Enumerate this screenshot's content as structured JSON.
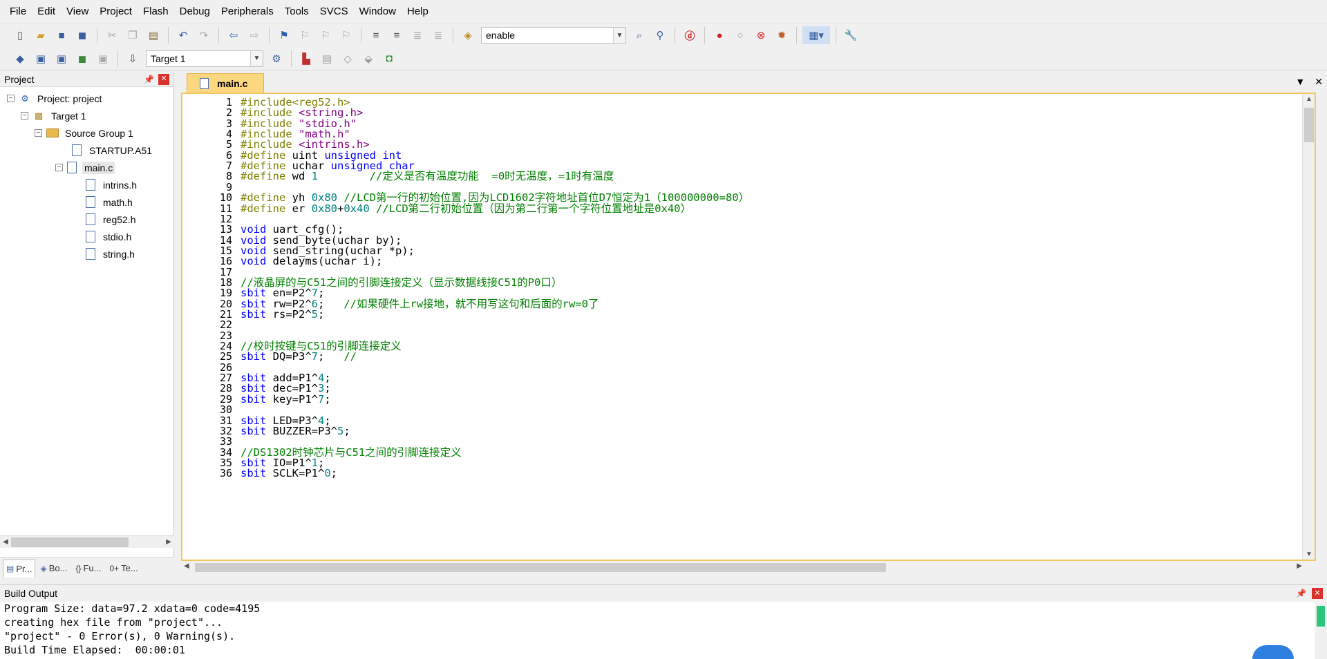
{
  "menu": [
    "File",
    "Edit",
    "View",
    "Project",
    "Flash",
    "Debug",
    "Peripherals",
    "Tools",
    "SVCS",
    "Window",
    "Help"
  ],
  "toolbar": {
    "find_combo_value": "enable",
    "target_combo_value": "Target 1"
  },
  "project_panel": {
    "title": "Project",
    "tree": [
      {
        "label": "Project: project",
        "level": 0,
        "kind": "project",
        "toggle": "-"
      },
      {
        "label": "Target 1",
        "level": 1,
        "kind": "target",
        "toggle": "-"
      },
      {
        "label": "Source Group 1",
        "level": 2,
        "kind": "folder",
        "toggle": "-"
      },
      {
        "label": "STARTUP.A51",
        "level": 3,
        "kind": "file",
        "toggle": ""
      },
      {
        "label": "main.c",
        "level": 3,
        "kind": "file",
        "toggle": "-",
        "selected": true
      },
      {
        "label": "intrins.h",
        "level": 4,
        "kind": "file",
        "toggle": ""
      },
      {
        "label": "math.h",
        "level": 4,
        "kind": "file",
        "toggle": ""
      },
      {
        "label": "reg52.h",
        "level": 4,
        "kind": "file",
        "toggle": ""
      },
      {
        "label": "stdio.h",
        "level": 4,
        "kind": "file",
        "toggle": ""
      },
      {
        "label": "string.h",
        "level": 4,
        "kind": "file",
        "toggle": ""
      }
    ],
    "bottom_tabs": [
      "Pr...",
      "Bo...",
      "Fu...",
      "Te..."
    ]
  },
  "editor": {
    "tab_label": "main.c",
    "lines": [
      {
        "n": "1",
        "parts": [
          [
            "pp",
            "#include<reg52.h>"
          ]
        ]
      },
      {
        "n": "2",
        "parts": [
          [
            "pp",
            "#include "
          ],
          [
            "str",
            "<string.h>"
          ]
        ]
      },
      {
        "n": "3",
        "parts": [
          [
            "pp",
            "#include "
          ],
          [
            "str",
            "\"stdio.h\""
          ]
        ]
      },
      {
        "n": "4",
        "parts": [
          [
            "pp",
            "#include "
          ],
          [
            "str",
            "\"math.h\""
          ]
        ]
      },
      {
        "n": "5",
        "parts": [
          [
            "pp",
            "#include "
          ],
          [
            "str",
            "<intrins.h>"
          ]
        ]
      },
      {
        "n": "6",
        "parts": [
          [
            "pp",
            "#define "
          ],
          [
            "",
            "uint "
          ],
          [
            "kw",
            "unsigned int"
          ]
        ]
      },
      {
        "n": "7",
        "parts": [
          [
            "pp",
            "#define "
          ],
          [
            "",
            "uchar "
          ],
          [
            "kw",
            "unsigned char"
          ]
        ]
      },
      {
        "n": "8",
        "parts": [
          [
            "pp",
            "#define "
          ],
          [
            "",
            "wd "
          ],
          [
            "num",
            "1"
          ],
          [
            "",
            "        "
          ],
          [
            "cm",
            "//定义是否有温度功能  =0时无温度，=1时有温度"
          ]
        ]
      },
      {
        "n": "9",
        "parts": []
      },
      {
        "n": "10",
        "parts": [
          [
            "pp",
            "#define "
          ],
          [
            "",
            "yh "
          ],
          [
            "num",
            "0x80"
          ],
          [
            "",
            " "
          ],
          [
            "cm",
            "//LCD第一行的初始位置,因为LCD1602字符地址首位D7恒定为1（100000000=80）"
          ]
        ]
      },
      {
        "n": "11",
        "parts": [
          [
            "pp",
            "#define "
          ],
          [
            "",
            "er "
          ],
          [
            "num",
            "0x80"
          ],
          [
            "",
            "+"
          ],
          [
            "num",
            "0x40"
          ],
          [
            "",
            " "
          ],
          [
            "cm",
            "//LCD第二行初始位置（因为第二行第一个字符位置地址是0x40）"
          ]
        ]
      },
      {
        "n": "12",
        "parts": []
      },
      {
        "n": "13",
        "parts": [
          [
            "kw",
            "void"
          ],
          [
            "",
            " uart_cfg();"
          ]
        ]
      },
      {
        "n": "14",
        "parts": [
          [
            "kw",
            "void"
          ],
          [
            "",
            " send_byte(uchar by);"
          ]
        ]
      },
      {
        "n": "15",
        "parts": [
          [
            "kw",
            "void"
          ],
          [
            "",
            " send_string(uchar *p);"
          ]
        ]
      },
      {
        "n": "16",
        "parts": [
          [
            "kw",
            "void"
          ],
          [
            "",
            " delayms(uchar i);"
          ]
        ]
      },
      {
        "n": "17",
        "parts": []
      },
      {
        "n": "18",
        "parts": [
          [
            "cm",
            "//液晶屏的与C51之间的引脚连接定义（显示数据线接C51的P0口）"
          ]
        ]
      },
      {
        "n": "19",
        "parts": [
          [
            "kw",
            "sbit"
          ],
          [
            "",
            " en=P2^"
          ],
          [
            "num",
            "7"
          ],
          [
            "",
            ";"
          ]
        ]
      },
      {
        "n": "20",
        "parts": [
          [
            "kw",
            "sbit"
          ],
          [
            "",
            " rw=P2^"
          ],
          [
            "num",
            "6"
          ],
          [
            "",
            ";   "
          ],
          [
            "cm",
            "//如果硬件上rw接地，就不用写这句和后面的rw=0了"
          ]
        ]
      },
      {
        "n": "21",
        "parts": [
          [
            "kw",
            "sbit"
          ],
          [
            "",
            " rs=P2^"
          ],
          [
            "num",
            "5"
          ],
          [
            "",
            ";"
          ]
        ]
      },
      {
        "n": "22",
        "parts": []
      },
      {
        "n": "23",
        "parts": []
      },
      {
        "n": "24",
        "parts": [
          [
            "cm",
            "//校时按键与C51的引脚连接定义"
          ]
        ]
      },
      {
        "n": "25",
        "parts": [
          [
            "kw",
            "sbit"
          ],
          [
            "",
            " DQ=P3^"
          ],
          [
            "num",
            "7"
          ],
          [
            "",
            ";   "
          ],
          [
            "cm",
            "//"
          ]
        ]
      },
      {
        "n": "26",
        "parts": []
      },
      {
        "n": "27",
        "parts": [
          [
            "kw",
            "sbit"
          ],
          [
            "",
            " add=P1^"
          ],
          [
            "num",
            "4"
          ],
          [
            "",
            ";"
          ]
        ]
      },
      {
        "n": "28",
        "parts": [
          [
            "kw",
            "sbit"
          ],
          [
            "",
            " dec=P1^"
          ],
          [
            "num",
            "3"
          ],
          [
            "",
            ";"
          ]
        ]
      },
      {
        "n": "29",
        "parts": [
          [
            "kw",
            "sbit"
          ],
          [
            "",
            " key=P1^"
          ],
          [
            "num",
            "7"
          ],
          [
            "",
            ";"
          ]
        ]
      },
      {
        "n": "30",
        "parts": []
      },
      {
        "n": "31",
        "parts": [
          [
            "kw",
            "sbit"
          ],
          [
            "",
            " LED=P3^"
          ],
          [
            "num",
            "4"
          ],
          [
            "",
            ";"
          ]
        ]
      },
      {
        "n": "32",
        "parts": [
          [
            "kw",
            "sbit"
          ],
          [
            "",
            " BUZZER=P3^"
          ],
          [
            "num",
            "5"
          ],
          [
            "",
            ";"
          ]
        ]
      },
      {
        "n": "33",
        "parts": []
      },
      {
        "n": "34",
        "parts": [
          [
            "cm",
            "//DS1302时钟芯片与C51之间的引脚连接定义"
          ]
        ]
      },
      {
        "n": "35",
        "parts": [
          [
            "kw",
            "sbit"
          ],
          [
            "",
            " IO=P1^"
          ],
          [
            "num",
            "1"
          ],
          [
            "",
            ";"
          ]
        ]
      },
      {
        "n": "36",
        "parts": [
          [
            "kw",
            "sbit"
          ],
          [
            "",
            " SCLK=P1^"
          ],
          [
            "num",
            "0"
          ],
          [
            "",
            ";"
          ]
        ]
      }
    ]
  },
  "build_output": {
    "title": "Build Output",
    "lines": [
      "Program Size: data=97.2 xdata=0 code=4195",
      "creating hex file from \"project\"...",
      "\"project\" - 0 Error(s), 0 Warning(s).",
      "Build Time Elapsed:  00:00:01"
    ]
  },
  "colors": {
    "tab_active": "#fbd77f",
    "editor_border": "#f5c761",
    "keyword": "#0000ff",
    "preprocessor": "#808000",
    "string": "#800080",
    "comment": "#008000",
    "number": "#008080"
  }
}
